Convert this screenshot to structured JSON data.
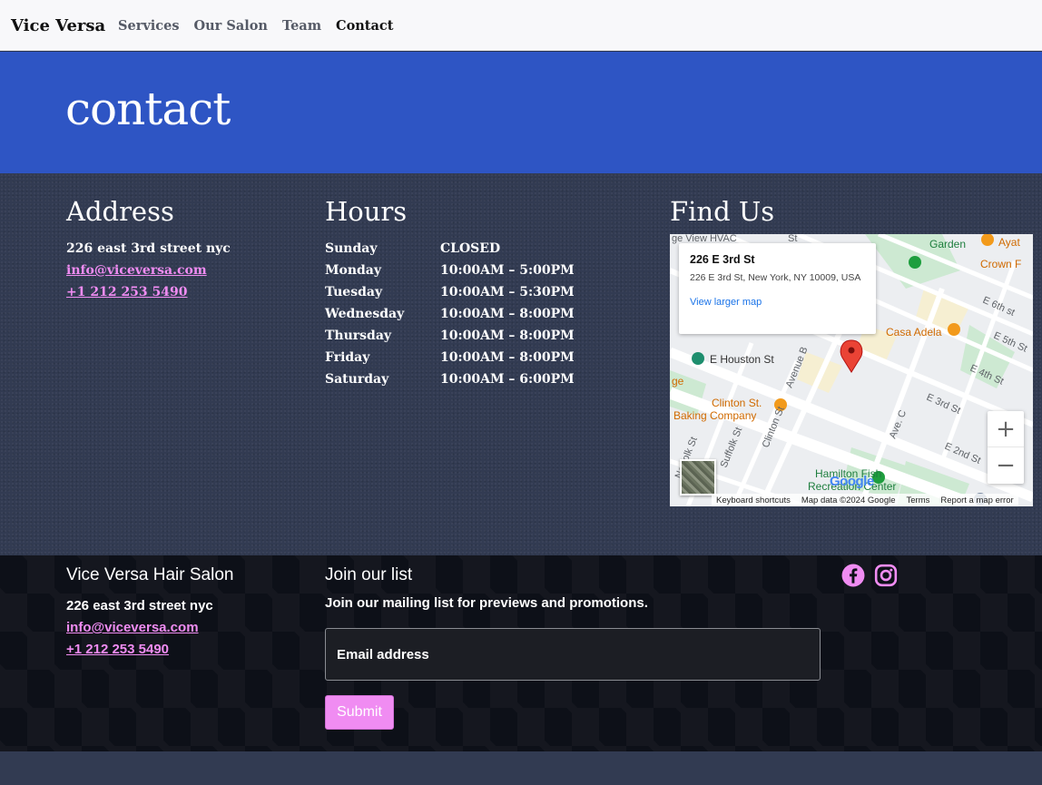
{
  "nav": {
    "brand": "Vice Versa",
    "items": [
      {
        "label": "Services",
        "active": false
      },
      {
        "label": "Our Salon",
        "active": false
      },
      {
        "label": "Team",
        "active": false
      },
      {
        "label": "Contact",
        "active": true
      }
    ]
  },
  "hero": {
    "title": "contact"
  },
  "address": {
    "title": "Address",
    "street": "226 east 3rd street nyc",
    "email": "info@viceversa.com",
    "phone": "+1 212 253 5490"
  },
  "hours": {
    "title": "Hours",
    "rows": [
      {
        "day": "Sunday",
        "time": "CLOSED"
      },
      {
        "day": "Monday",
        "time": "10:00AM – 5:00PM"
      },
      {
        "day": "Tuesday",
        "time": "10:00AM – 5:30PM"
      },
      {
        "day": "Wednesday",
        "time": "10:00AM – 8:00PM"
      },
      {
        "day": "Thursday",
        "time": "10:00AM – 8:00PM"
      },
      {
        "day": "Friday",
        "time": "10:00AM – 8:00PM"
      },
      {
        "day": "Saturday",
        "time": "10:00AM – 6:00PM"
      }
    ]
  },
  "findus": {
    "title": "Find Us",
    "map": {
      "card_title": "226 E 3rd St",
      "card_address": "226 E 3rd St, New York, NY 10009, USA",
      "card_link": "View larger map",
      "zoom_in": "+",
      "zoom_out": "−",
      "footer": {
        "shortcuts": "Keyboard shortcuts",
        "mapdata": "Map data ©2024 Google",
        "terms": "Terms",
        "report": "Report a map error"
      },
      "google": "Google",
      "labels": {
        "hvac": "ge View HVAC",
        "garden": "Garden",
        "crown": "Crown F",
        "ayat": "Ayat",
        "casa": "Casa Adela",
        "ehouston": "E Houston St",
        "clinton": "Clinton St.",
        "baking": "Baking Company",
        "hamilton1": "Hamilton Fish",
        "hamilton2": "Recreation Center",
        "e6th": "E 6th st",
        "e5th": "E 5th St",
        "e4th": "E 4th St",
        "e3rd": "E 3rd St",
        "e2nd": "E 2nd St",
        "aveb": "Avenue B",
        "avec": "Ave. C",
        "suffolk": "Suffolk St",
        "norfolk": "Norfolk St",
        "clintonst": "Clinton St",
        "st": "St",
        "ge": "ge"
      }
    }
  },
  "footer": {
    "salon_title": "Vice Versa Hair Salon",
    "street": "226 east 3rd street nyc",
    "email": "info@viceversa.com",
    "phone": "+1 212 253 5490",
    "list_title": "Join our list",
    "list_desc": "Join our mailing list for previews and promotions.",
    "email_placeholder": "Email address",
    "submit_label": "Submit",
    "social": [
      "facebook-icon",
      "instagram-icon"
    ]
  },
  "colors": {
    "hero": "#2e55c4",
    "accent_pink": "#f08cf2",
    "footer_bg": "#0d1018",
    "band_bg": "#323b52"
  }
}
